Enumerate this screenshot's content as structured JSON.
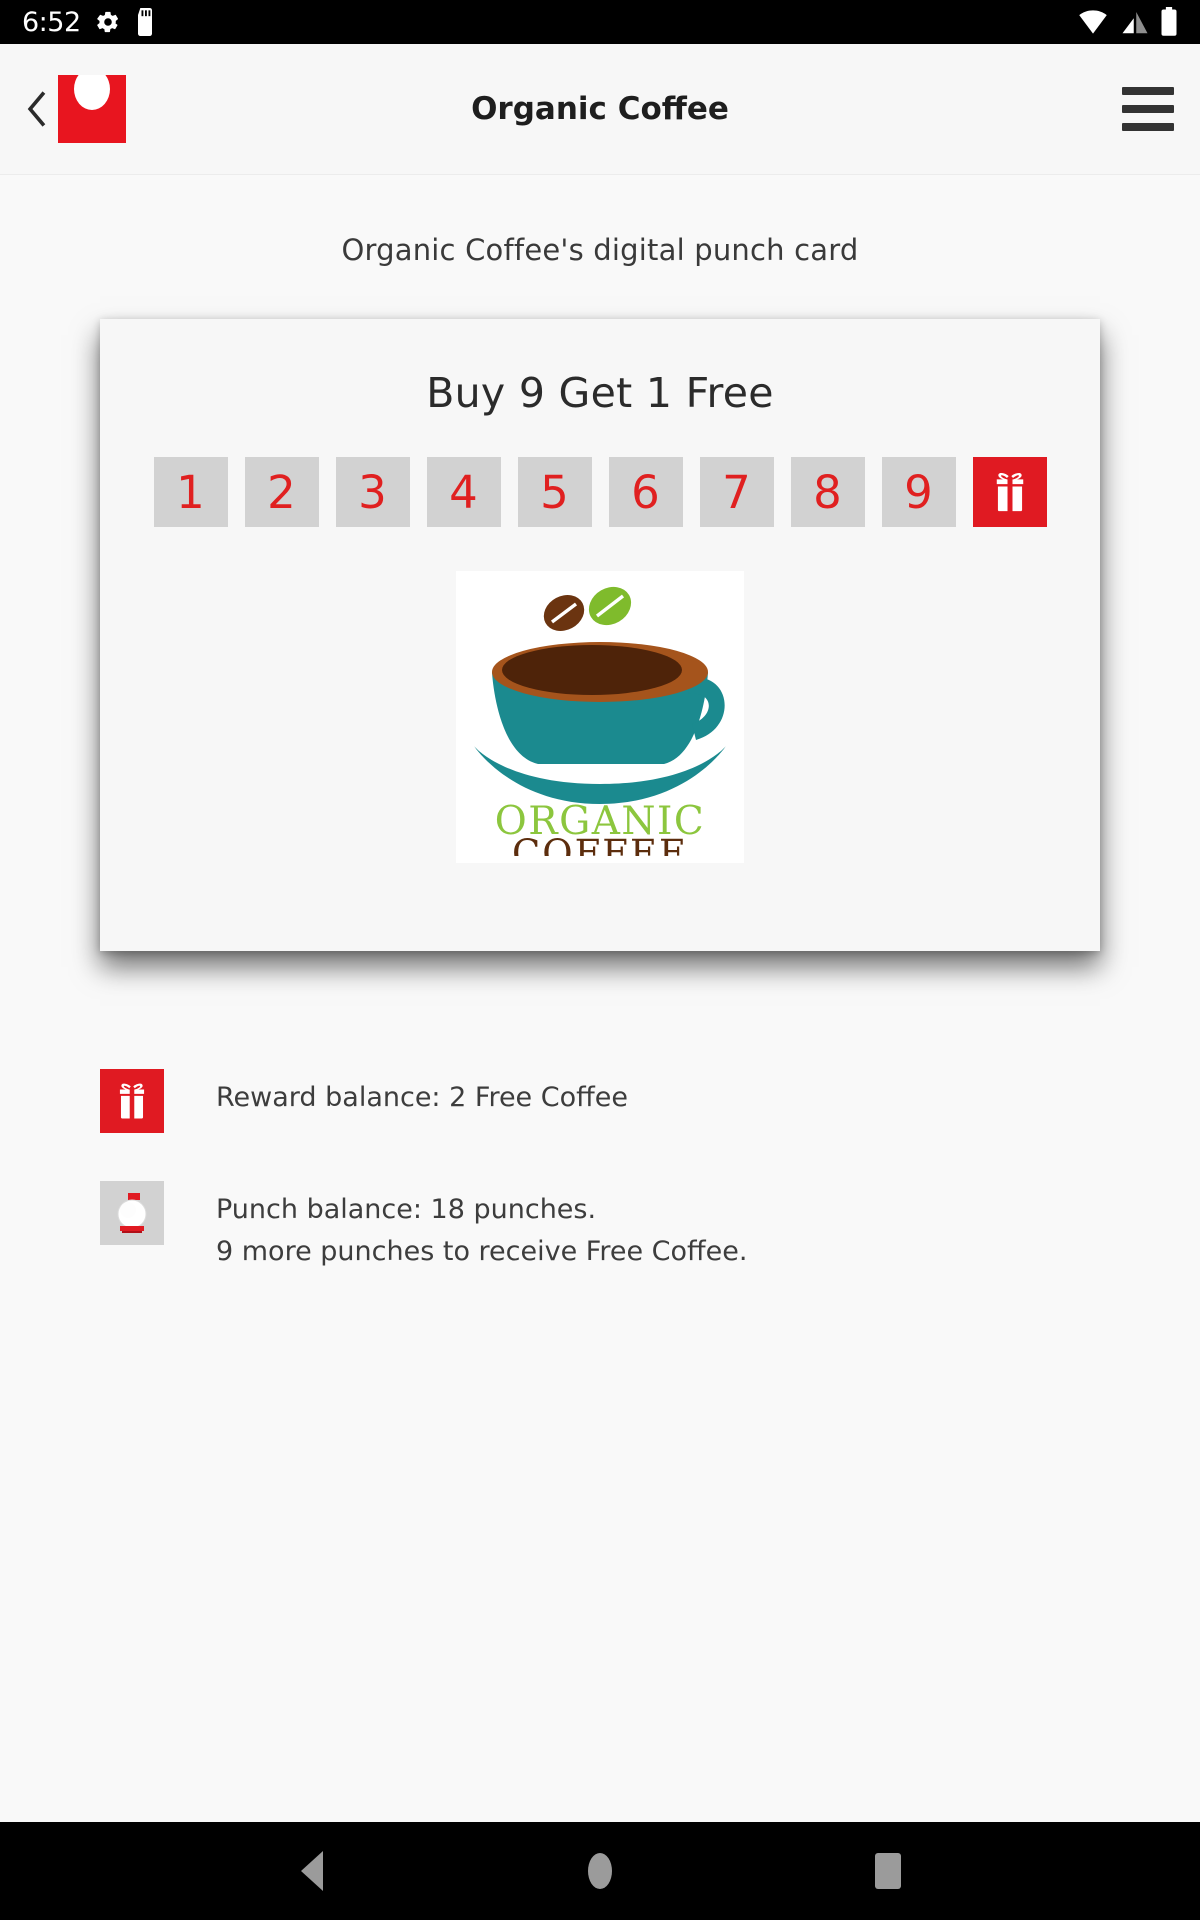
{
  "status_bar": {
    "time": "6:52",
    "icons": [
      "gear-icon",
      "sd-card-icon",
      "wifi-icon",
      "cellular-signal-icon",
      "battery-icon"
    ]
  },
  "app_bar": {
    "back_label": "‹",
    "logo_name": "punchh-brand-logo",
    "title": "Organic Coffee",
    "menu_name": "hamburger-menu"
  },
  "main": {
    "subtitle": "Organic Coffee's digital punch card",
    "card": {
      "offer_title": "Buy 9 Get 1 Free",
      "slots": [
        "1",
        "2",
        "3",
        "4",
        "5",
        "6",
        "7",
        "8",
        "9"
      ],
      "reward_slot_icon": "gift-icon",
      "merchant_logo": {
        "name": "organic-coffee-logo",
        "word_top": "ORGANIC",
        "word_bottom": "COFFEE"
      }
    },
    "balances": [
      {
        "icon": "gift-icon",
        "lines": [
          "Reward balance: 2 Free Coffee"
        ]
      },
      {
        "icon": "punch-icon",
        "lines": [
          "Punch balance: 18 punches.",
          "9 more punches to receive Free Coffee."
        ]
      }
    ]
  },
  "nav_bar": {
    "back": "back-triangle-icon",
    "home": "home-circle-icon",
    "recents": "recents-square-icon"
  },
  "colors": {
    "brand_red": "#e01a22",
    "punch_number_red": "#e02020",
    "slot_gray": "#d2d2d2",
    "page_bg": "#f9f9f9",
    "logo_teal": "#1b8a8f",
    "logo_brown": "#6b3410",
    "logo_green": "#8cc63e"
  }
}
